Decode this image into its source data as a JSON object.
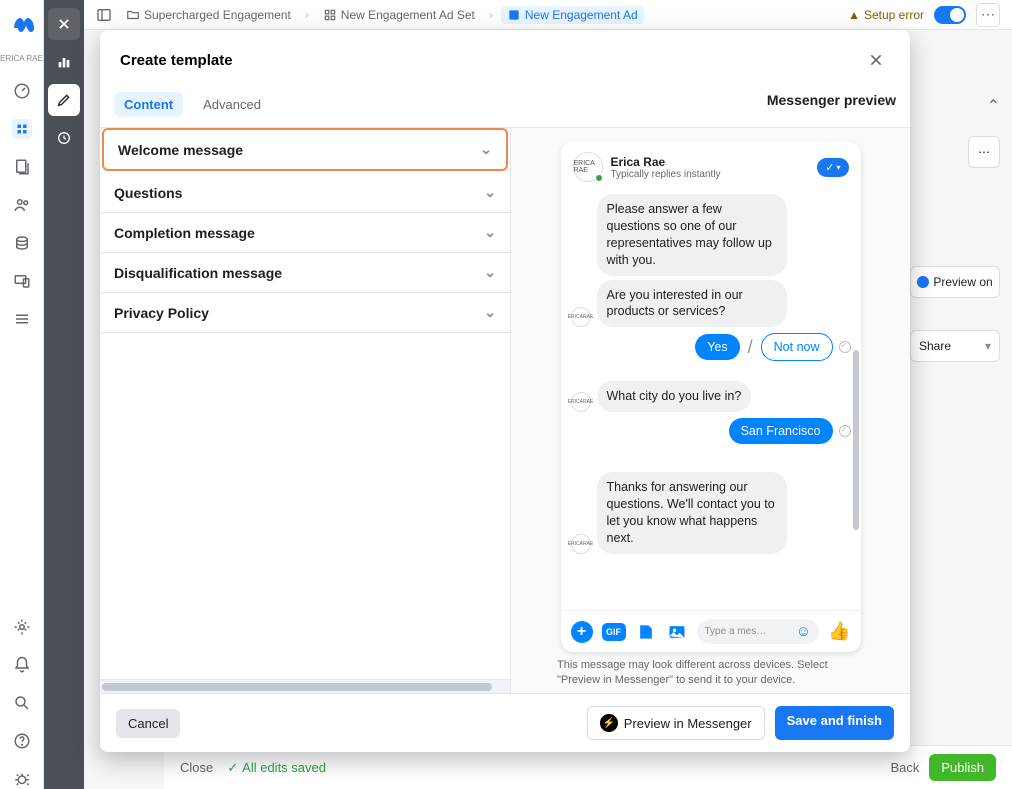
{
  "rail1_brand": "ERICA RAE",
  "topbar": {
    "campaign": "Supercharged Engagement",
    "adset": "New Engagement Ad Set",
    "ad": "New Engagement Ad",
    "setup_error": "Setup error"
  },
  "bg": {
    "preview_on": "Preview on",
    "share": "Share"
  },
  "footer": {
    "close": "Close",
    "all_saved": "All edits saved",
    "back": "Back",
    "publish": "Publish"
  },
  "modal": {
    "title": "Create template",
    "tabs": {
      "content": "Content",
      "advanced": "Advanced"
    },
    "sections": {
      "welcome": "Welcome message",
      "questions": "Questions",
      "completion": "Completion message",
      "disqualification": "Disqualification message",
      "privacy": "Privacy Policy"
    },
    "preview_title": "Messenger preview",
    "sender": {
      "name": "Erica Rae",
      "sub": "Typically replies instantly"
    },
    "msg_intro": "Please answer a few questions so one of our representatives may follow up with you.",
    "msg_q1": "Are you interested in our products or services?",
    "ans_yes": "Yes",
    "ans_notnow": "Not now",
    "msg_q2": "What city do you live in?",
    "ans_city": "San Francisco",
    "msg_thanks": "Thanks for answering our questions. We'll contact you to let you know what happens next.",
    "composer_placeholder": "Type a mes…",
    "gif_label": "GIF",
    "disclaimer": "This message may look different across devices. Select \"Preview in Messenger\" to send it to your device.",
    "cancel": "Cancel",
    "preview_btn": "Preview in Messenger",
    "save_btn": "Save and finish"
  }
}
